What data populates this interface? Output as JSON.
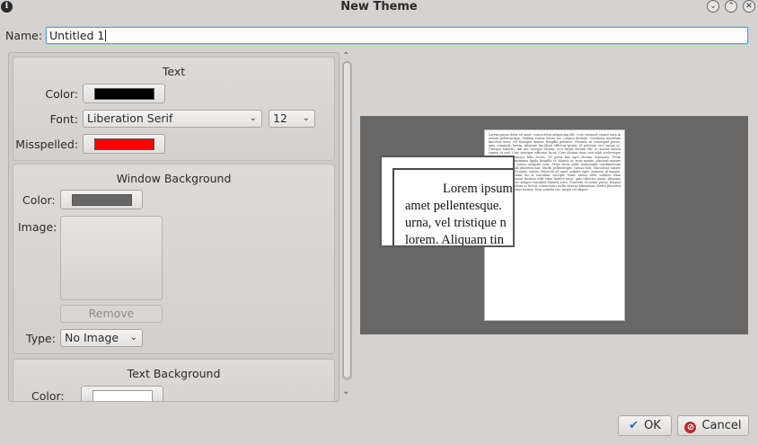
{
  "window": {
    "title": "New Theme"
  },
  "name_field": {
    "label": "Name:",
    "value": "Untitled 1"
  },
  "text_group": {
    "title": "Text",
    "color_label": "Color:",
    "color": "#000000",
    "font_label": "Font:",
    "font_value": "Liberation Serif",
    "size_value": "12",
    "misspelled_label": "Misspelled:",
    "misspelled_color": "#ff0000"
  },
  "window_background": {
    "title": "Window Background",
    "color_label": "Color:",
    "color": "#676767",
    "image_label": "Image:",
    "remove_label": "Remove",
    "type_label": "Type:",
    "type_value": "No Image"
  },
  "text_background": {
    "title": "Text Background",
    "color_label": "Color:",
    "color": "#ffffff"
  },
  "preview": {
    "page_text": "Lorem ipsum dolor sit amet, consectetur adipiscing elit. Cras euismod ornare uma in ornare pellentesque. Nullam varius lorem nec congue facilisis. Curabitur interdum faucibus urna, vel tristique mauris fringilla pulvinar. Vivamus in consequat purus, quis commodo lorem. Aliquam tincidunt efficitur ipsum, id pulvinar orci varius ut. Quisque lobortis, dui nec suscipit dictum, orci turpis dictum elit, ut auctor massa sapien et nisl. Cras tristique efficitur lacus. Cras dictum risus non nibh scelerisque ornare. Morbi tempor felis lectus. Ut porta nisi eget dictum venenatis. Proin interdum turpis maximus ligula fringilla et. Mauris ac risus mattis, placerat mauris nisl, consectetur tortor. Aliquam erat. Proin lacus nibh, malesuada condimentum risus et, malesuada pharetra nisl. Morbi pellentesque cursus felis. Maecenas ornare risus, congue sed turpis, varius. Vehicula sit amet sodales eget, posuere id magna. Suspendisse pretium leo at tincidunt suscipit. Nunc varius velit, sodales vitae tempor quis. Praesent facilisis velit vitae laoreet nunc, quis ultricies quam. Aliquam sem lectus, ultrices semper tincidunt blandit justo. Praesent et lorem purus, feugiat sapien eu, vestibulum ut lectus consectetur nulla viverra bibendum. Morbi pharetra dignissim tortor vitae lacinia. Duis sodales nec turpis vel aliquet",
    "zoom_lines": [
      "Lorem ipsum",
      "amet pellentesque.",
      "urna, vel tristique n",
      "lorem. Aliquam tin"
    ]
  },
  "footer": {
    "ok_label": "OK",
    "cancel_label": "Cancel"
  }
}
